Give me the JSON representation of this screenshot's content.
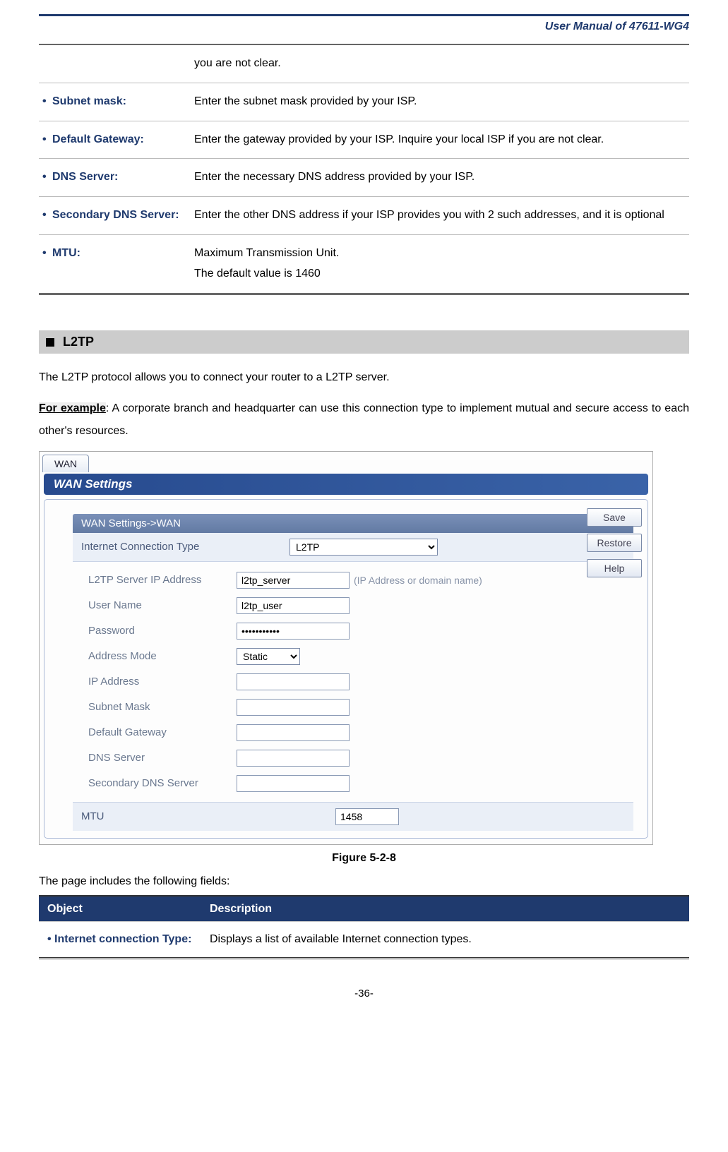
{
  "header": {
    "title": "User Manual of 47611-WG4"
  },
  "param_table": {
    "rows": [
      {
        "label": "",
        "desc": "you are not clear."
      },
      {
        "label": "Subnet mask:",
        "desc": "Enter the subnet mask provided by your ISP."
      },
      {
        "label": "Default Gateway:",
        "desc": "Enter the gateway provided by your ISP. Inquire your local ISP if you are not clear."
      },
      {
        "label": "DNS Server:",
        "desc": "Enter the necessary DNS address provided by your ISP."
      },
      {
        "label": "Secondary DNS Server:",
        "desc": "Enter the other DNS address if your ISP provides you with 2 such addresses, and it is optional"
      },
      {
        "label": "MTU:",
        "desc": "Maximum Transmission Unit.\nThe default value is 1460"
      }
    ]
  },
  "section": {
    "heading": "L2TP",
    "intro1": "The L2TP protocol allows you to connect your router to a L2TP server.",
    "intro2_prefix": "For example",
    "intro2_rest": ": A corporate branch and headquarter can use this connection type to implement mutual and secure access to each other's resources."
  },
  "wan": {
    "tab": "WAN",
    "title": "WAN Settings",
    "sub_header": "WAN Settings->WAN",
    "conn_label": "Internet Connection Type",
    "conn_value": "L2TP",
    "fields": {
      "server_label": "L2TP Server IP Address",
      "server_value": "l2tp_server",
      "server_hint": "(IP Address or domain name)",
      "user_label": "User Name",
      "user_value": "l2tp_user",
      "pass_label": "Password",
      "pass_value": "•••••••••••",
      "addrmode_label": "Address Mode",
      "addrmode_value": "Static",
      "ip_label": "IP Address",
      "subnet_label": "Subnet Mask",
      "gateway_label": "Default Gateway",
      "dns_label": "DNS Server",
      "dns2_label": "Secondary DNS Server"
    },
    "mtu_label": "MTU",
    "mtu_value": "1458",
    "buttons": {
      "save": "Save",
      "restore": "Restore",
      "help": "Help"
    }
  },
  "figure_caption": "Figure 5-2-8",
  "fields_intro": "The page includes the following fields:",
  "obj_table": {
    "col1": "Object",
    "col2": "Description",
    "row1_label": "Internet connection Type:",
    "row1_desc": "Displays a list of available Internet connection types."
  },
  "page_num": "-36-"
}
